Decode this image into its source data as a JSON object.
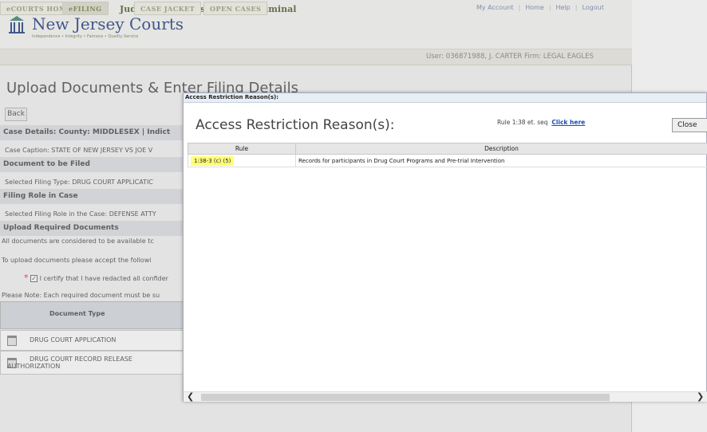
{
  "header": {
    "system_title": "Judiciary eCourts System - Criminal",
    "brand": "New Jersey Courts",
    "tagline": "Independence • Integrity • Fairness • Quality Service",
    "links": [
      "My Account",
      "Home",
      "Help",
      "Logout"
    ],
    "user_line": "User: 036871988, J. CARTER  Firm: LEGAL EAGLES"
  },
  "nav": {
    "tabs": [
      "eCOURTS HOME",
      "eFILING",
      "CASE JACKET",
      "OPEN CASES"
    ]
  },
  "main": {
    "title": "Upload Documents & Enter Filing Details",
    "back": "Back",
    "case_details": "Case Details: County: MIDDLESEX | Indict",
    "case_caption": "Case Caption: STATE OF NEW JERSEY VS JOE V",
    "document_to_be_filed": "Document to be Filed",
    "selected_filing_type": "Selected Filing Type: DRUG COURT APPLICATIC",
    "filing_role": "Filing Role in Case",
    "selected_filing_role": "Selected Filing Role in the Case: DEFENSE ATTY",
    "upload_required": "Upload Required Documents",
    "all_docs": "All documents are considered to be available tc",
    "to_upload": "To upload documents please accept the followi",
    "certify": "I certify that I have redacted all confider",
    "please_note": "Please Note: Each required document must be su",
    "doc_type_header": "Document Type",
    "docs": [
      "DRUG COURT APPLICATION",
      "DRUG COURT RECORD RELEASE",
      "AUTHORIZATION"
    ]
  },
  "modal": {
    "titlebar": "Access Restriction Reason(s):",
    "heading": "Access Restriction Reason(s):",
    "rule_ref_text": "Rule 1:38 et. seq",
    "rule_ref_link": "Click here",
    "close": "Close",
    "columns": [
      "Rule",
      "Description"
    ],
    "rows": [
      {
        "rule": "1:38-3 (c)  (5)",
        "description": "Records for participants in Drug Court Programs and Pre-trial Intervention"
      }
    ]
  }
}
